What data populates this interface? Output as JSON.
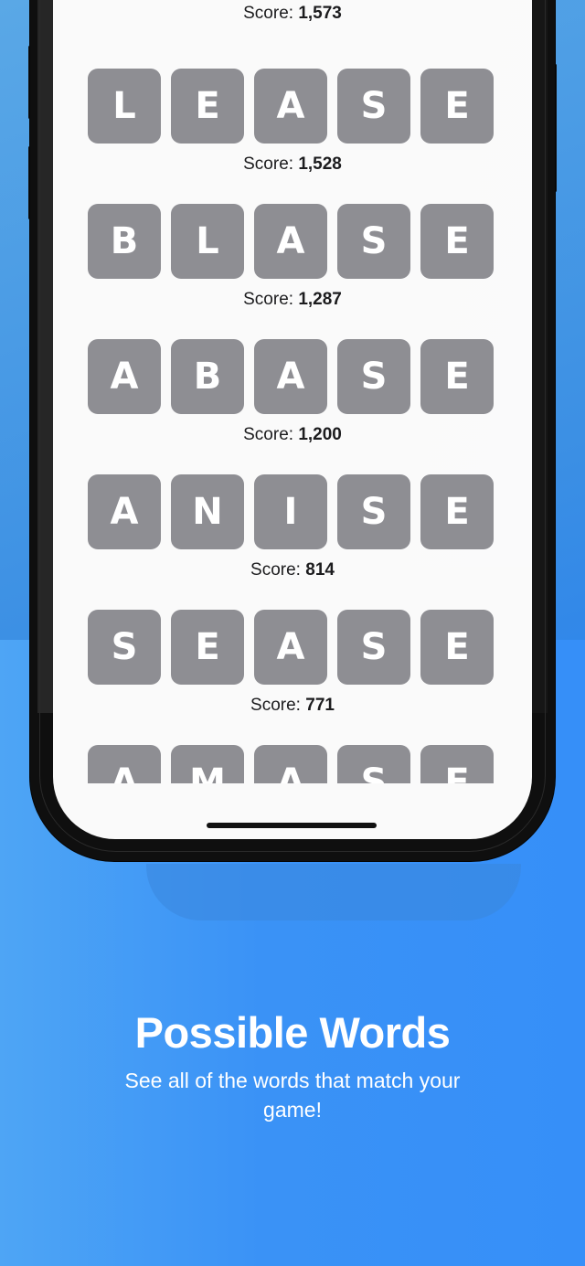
{
  "colors": {
    "tile_background": "#8e8e93",
    "tile_letter": "#ffffff",
    "screen_background": "#fafafa",
    "page_background": "#388ff6"
  },
  "words": [
    {
      "letters": [
        "",
        "",
        "",
        "",
        ""
      ],
      "score_label": "Score:",
      "score": "1,573"
    },
    {
      "letters": [
        "L",
        "E",
        "A",
        "S",
        "E"
      ],
      "score_label": "Score:",
      "score": "1,528"
    },
    {
      "letters": [
        "B",
        "L",
        "A",
        "S",
        "E"
      ],
      "score_label": "Score:",
      "score": "1,287"
    },
    {
      "letters": [
        "A",
        "B",
        "A",
        "S",
        "E"
      ],
      "score_label": "Score:",
      "score": "1,200"
    },
    {
      "letters": [
        "A",
        "N",
        "I",
        "S",
        "E"
      ],
      "score_label": "Score:",
      "score": "814"
    },
    {
      "letters": [
        "S",
        "E",
        "A",
        "S",
        "E"
      ],
      "score_label": "Score:",
      "score": "771"
    },
    {
      "letters": [
        "A",
        "M",
        "A",
        "S",
        "E"
      ],
      "score_label": "",
      "score": ""
    }
  ],
  "promo": {
    "title": "Possible Words",
    "subtitle": "See all of the words that match your game!"
  }
}
